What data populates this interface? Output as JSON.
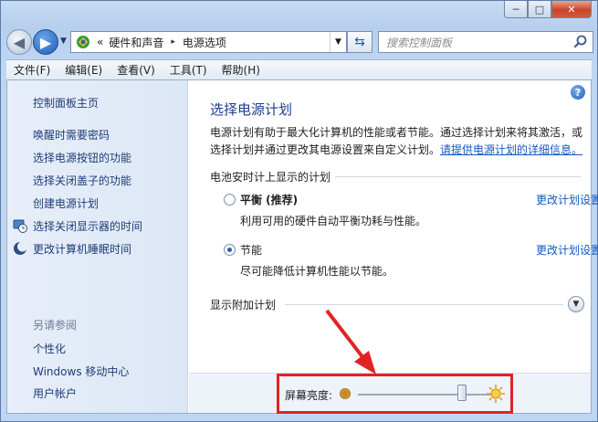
{
  "window": {
    "caption": {
      "minimize": "─",
      "maximize": "□",
      "close": "✕"
    }
  },
  "address": {
    "chevrons": "«",
    "crumbs": [
      "硬件和声音",
      "电源选项"
    ],
    "separator": "▸"
  },
  "search": {
    "placeholder": "搜索控制面板"
  },
  "menu": [
    "文件(F)",
    "编辑(E)",
    "查看(V)",
    "工具(T)",
    "帮助(H)"
  ],
  "sidebar": {
    "items": [
      {
        "label": "控制面板主页"
      },
      {
        "label": "唤醒时需要密码"
      },
      {
        "label": "选择电源按钮的功能"
      },
      {
        "label": "选择关闭盖子的功能"
      },
      {
        "label": "创建电源计划"
      },
      {
        "label": "选择关闭显示器的时间",
        "icon": "display-clock-icon"
      },
      {
        "label": "更改计算机睡眠时间",
        "icon": "moon-sleep-icon"
      }
    ],
    "see_also_heading": "另请参阅",
    "see_also": [
      "个性化",
      "Windows 移动中心",
      "用户帐户"
    ]
  },
  "main": {
    "help": "?",
    "title": "选择电源计划",
    "description_line1": "电源计划有助于最大化计算机的性能或者节能。通过选择计划来将其激活，或",
    "description_line2": "选择计划并通过更改其电源设置来自定义计划。",
    "description_link": "请提供电源计划的详细信息。",
    "group_label": "电池安时计上显示的计划",
    "plans": [
      {
        "name": "平衡 (推荐)",
        "description": "利用可用的硬件自动平衡功耗与性能。",
        "link": "更改计划设置",
        "selected": false
      },
      {
        "name": "节能",
        "description": "尽可能降低计算机性能以节能。",
        "link": "更改计划设置",
        "selected": true
      }
    ],
    "extra_plans_label": "显示附加计划"
  },
  "brightness": {
    "label": "屏幕亮度:",
    "level_fraction": 0.78
  },
  "colors": {
    "accent_link": "#1558c0",
    "highlight": "#e02424"
  }
}
